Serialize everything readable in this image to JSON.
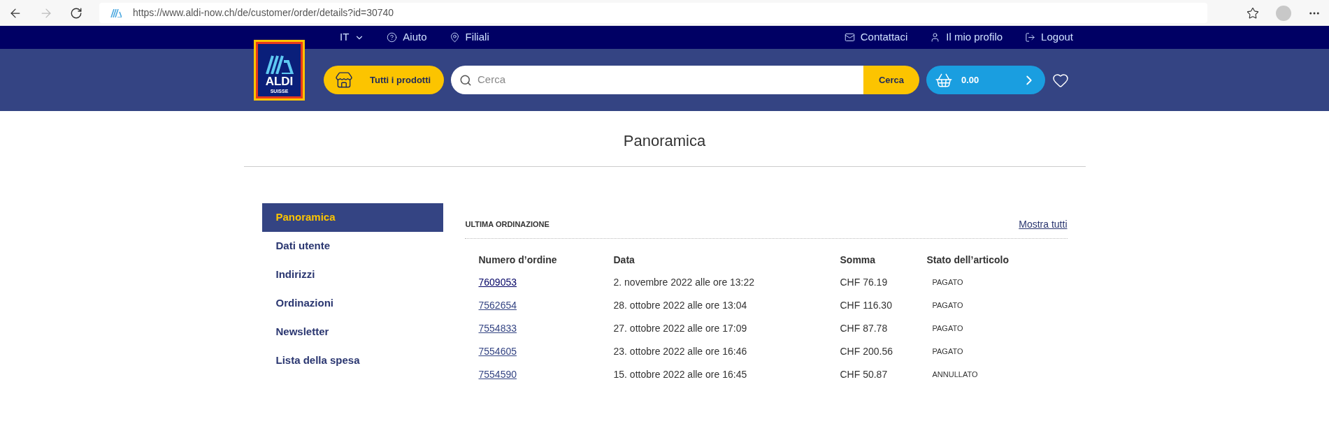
{
  "browser": {
    "url": "https://www.aldi-now.ch/de/customer/order/details?id=30740"
  },
  "top_nav": {
    "language": "IT",
    "left_links": [
      {
        "label": "Aiuto",
        "kind": "help"
      },
      {
        "label": "Filiali",
        "kind": "stores"
      }
    ],
    "right_links": [
      {
        "label": "Contattaci",
        "kind": "contact"
      },
      {
        "label": "Il mio profilo",
        "kind": "profile"
      },
      {
        "label": "Logout",
        "kind": "logout"
      }
    ]
  },
  "logo": {
    "brand": "ALDI",
    "region": "SUISSE"
  },
  "header": {
    "all_products": "Tutti i prodotti",
    "search": {
      "placeholder": "Cerca",
      "button": "Cerca"
    },
    "cart_total": "0.00"
  },
  "page_title": "Panoramica",
  "sidebar": {
    "items": [
      {
        "label": "Panoramica",
        "selected": true
      },
      {
        "label": "Dati utente",
        "selected": false
      },
      {
        "label": "Indirizzi",
        "selected": false
      },
      {
        "label": "Ordinazioni",
        "selected": false
      },
      {
        "label": "Newsletter",
        "selected": false
      },
      {
        "label": "Lista della spesa",
        "selected": false
      }
    ]
  },
  "orders": {
    "title": "ULTIMA ORDINAZIONE",
    "show_all": "Mostra tutti",
    "columns": [
      "Numero d’ordine",
      "Data",
      "Somma",
      "Stato dell’articolo"
    ],
    "rows": [
      {
        "number": "7609053",
        "date": "2. novembre 2022 alle ore 13:22",
        "sum": "CHF 76.19",
        "status": "PAGATO"
      },
      {
        "number": "7562654",
        "date": "28. ottobre 2022 alle ore 13:04",
        "sum": "CHF 116.30",
        "status": "PAGATO"
      },
      {
        "number": "7554833",
        "date": "27. ottobre 2022 alle ore 17:09",
        "sum": "CHF 87.78",
        "status": "PAGATO"
      },
      {
        "number": "7554605",
        "date": "23. ottobre 2022 alle ore 16:46",
        "sum": "CHF 200.56",
        "status": "PAGATO"
      },
      {
        "number": "7554590",
        "date": "15. ottobre 2022 alle ore 16:45",
        "sum": "CHF 50.87",
        "status": "ANNULLATO"
      }
    ]
  }
}
